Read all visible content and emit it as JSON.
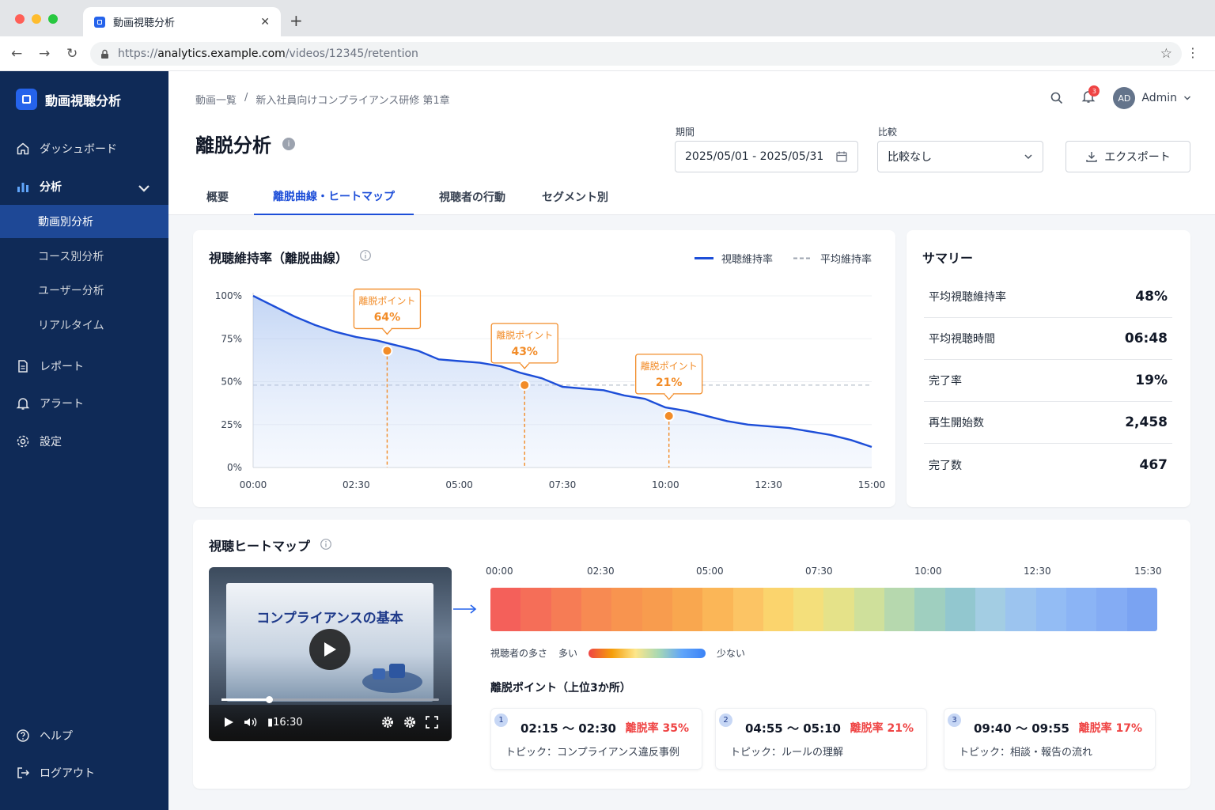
{
  "browser": {
    "tab_title": "動画視聴分析",
    "url_prefix": "https://",
    "url_host": "analytics.example.com",
    "url_path": "/videos/12345/retention"
  },
  "sidebar": {
    "brand": "動画視聴分析",
    "items": [
      {
        "label": "ダッシュボード",
        "icon": "home-icon"
      },
      {
        "label": "分析",
        "icon": "bar-chart-icon"
      },
      {
        "label": "レポート",
        "icon": "document-icon"
      },
      {
        "label": "アラート",
        "icon": "bell-icon"
      },
      {
        "label": "設定",
        "icon": "gear-icon"
      }
    ],
    "sub_items": [
      {
        "label": "動画別分析",
        "active": true
      },
      {
        "label": "コース別分析"
      },
      {
        "label": "ユーザー分析"
      },
      {
        "label": "リアルタイム"
      }
    ],
    "bottom": [
      {
        "label": "ヘルプ",
        "icon": "help-icon"
      },
      {
        "label": "ログアウト",
        "icon": "logout-icon"
      }
    ]
  },
  "header": {
    "breadcrumb": [
      "動画一覧",
      "/",
      "新入社員向けコンプライアンス研修 第1章"
    ],
    "notification_count": "3",
    "user_initials": "AD",
    "user_name": "Admin",
    "title": "離脱分析",
    "info": "i",
    "period_label": "期間",
    "period_value": "2025/05/01 - 2025/05/31",
    "compare_label": "比較",
    "compare_value": "比較なし",
    "export_label": "エクスポート",
    "tabs": [
      "概要",
      "離脱曲線・ヒートマップ",
      "視聴者の行動",
      "セグメント別"
    ]
  },
  "retention": {
    "title": "視聴維持率（離脱曲線）",
    "legend_main": "視聴維持率",
    "legend_avg": "平均維持率",
    "drop_label": "離脱ポイント"
  },
  "chart_data": {
    "type": "area",
    "title": "視聴維持率（離脱曲線）",
    "x_ticks": [
      "00:00",
      "02:30",
      "05:00",
      "07:30",
      "10:00",
      "12:30",
      "15:00"
    ],
    "y_ticks": [
      "100%",
      "75%",
      "50%",
      "25%",
      "0%"
    ],
    "ylim": [
      0,
      100
    ],
    "xlim_seconds": [
      0,
      900
    ],
    "series": [
      {
        "name": "視聴維持率",
        "x_seconds": [
          0,
          30,
          60,
          90,
          120,
          150,
          180,
          210,
          240,
          270,
          300,
          330,
          360,
          390,
          420,
          450,
          480,
          510,
          540,
          570,
          600,
          630,
          660,
          690,
          720,
          750,
          780,
          810,
          840,
          870,
          900
        ],
        "values": [
          100,
          94,
          88,
          83,
          79,
          76,
          74,
          71,
          68,
          63,
          62,
          61,
          59,
          55,
          52,
          47,
          46,
          45,
          42,
          40,
          35,
          33,
          30,
          27,
          25,
          24,
          23,
          21,
          19,
          16,
          12
        ]
      },
      {
        "name": "平均維持率",
        "value": 48
      }
    ],
    "drop_points": [
      {
        "x_seconds": 195,
        "value": 68,
        "label": "64%"
      },
      {
        "x_seconds": 395,
        "value": 48,
        "label": "43%"
      },
      {
        "x_seconds": 605,
        "value": 30,
        "label": "21%"
      }
    ],
    "legend": "top-right",
    "grid": true
  },
  "summary": {
    "title": "サマリー",
    "rows": [
      {
        "label": "平均視聴維持率",
        "value": "48%"
      },
      {
        "label": "平均視聴時間",
        "value": "06:48"
      },
      {
        "label": "完了率",
        "value": "19%"
      },
      {
        "label": "再生開始数",
        "value": "2,458"
      },
      {
        "label": "完了数",
        "value": "467"
      }
    ]
  },
  "heatmap": {
    "title": "視聴ヒートマップ",
    "video_title": "コンプライアンスの基本",
    "video_time": "16:30",
    "ticks": [
      "00:00",
      "02:30",
      "05:00",
      "07:30",
      "10:00",
      "12:30",
      "15:30"
    ],
    "colors": [
      "#f4605a",
      "#f56e58",
      "#f67c55",
      "#f78a52",
      "#f8944f",
      "#f89c4e",
      "#f9a74f",
      "#fbb657",
      "#fcc464",
      "#fbd46d",
      "#f4df7b",
      "#e5e289",
      "#cfe09b",
      "#b6d8ae",
      "#9fcfbf",
      "#92c7cf",
      "#a3cde3",
      "#9cc4ef",
      "#93bcf4",
      "#8bb4f5",
      "#84acf4",
      "#7aa3f2"
    ],
    "scale_label": "視聴者の多さ",
    "scale_high": "多い",
    "scale_low": "少ない",
    "drop_title": "離脱ポイント（上位3か所）",
    "drops": [
      {
        "num": "1",
        "range": "02:15 〜 02:30",
        "rate": "離脱率 35%",
        "topic": "トピック：コンプライアンス違反事例"
      },
      {
        "num": "2",
        "range": "04:55 〜 05:10",
        "rate": "離脱率 21%",
        "topic": "トピック：ルールの理解"
      },
      {
        "num": "3",
        "range": "09:40 〜 09:55",
        "rate": "離脱率 17%",
        "topic": "トピック：相談・報告の流れ"
      }
    ]
  }
}
